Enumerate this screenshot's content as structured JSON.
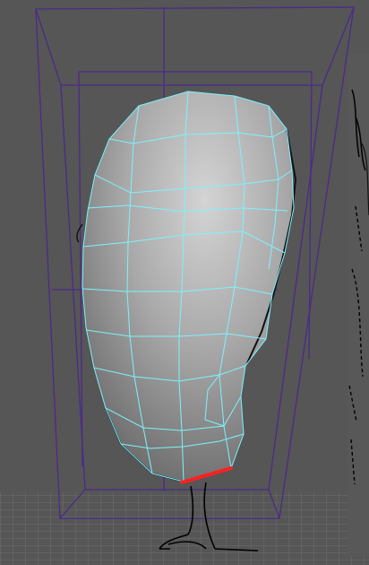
{
  "viewport": {
    "panel": "3d-perspective-viewport",
    "content": "polygon-mesh-head-wireframe-on-shaded",
    "colors": {
      "background": "#565656",
      "floor_grid": "#6f6f6f",
      "bounding_box": "#4b2a8a",
      "wireframe": "#7df2ff",
      "selected_edge": "#ff2020",
      "sketch_lines": "#000000",
      "image_plane": "#8a8a8a"
    }
  }
}
